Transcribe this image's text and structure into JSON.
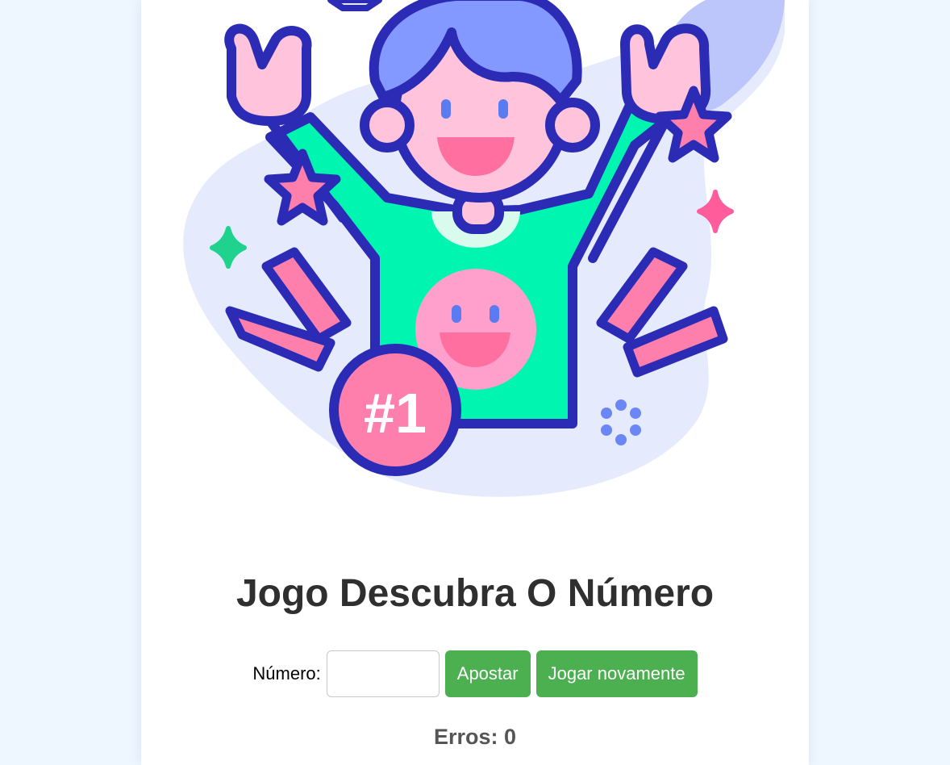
{
  "game": {
    "title": "Jogo Descubra O Número",
    "badge_text": "#1"
  },
  "form": {
    "number_label": "Número:",
    "number_value": "",
    "bet_button": "Apostar",
    "replay_button": "Jogar novamente"
  },
  "status": {
    "errors_text": "Erros: 0"
  },
  "colors": {
    "page_bg": "#eef6ff",
    "button_green": "#4caf50",
    "outline_navy": "#2b2bb5",
    "shirt_green": "#00f5b0",
    "accent_pink": "#ff7fac"
  }
}
